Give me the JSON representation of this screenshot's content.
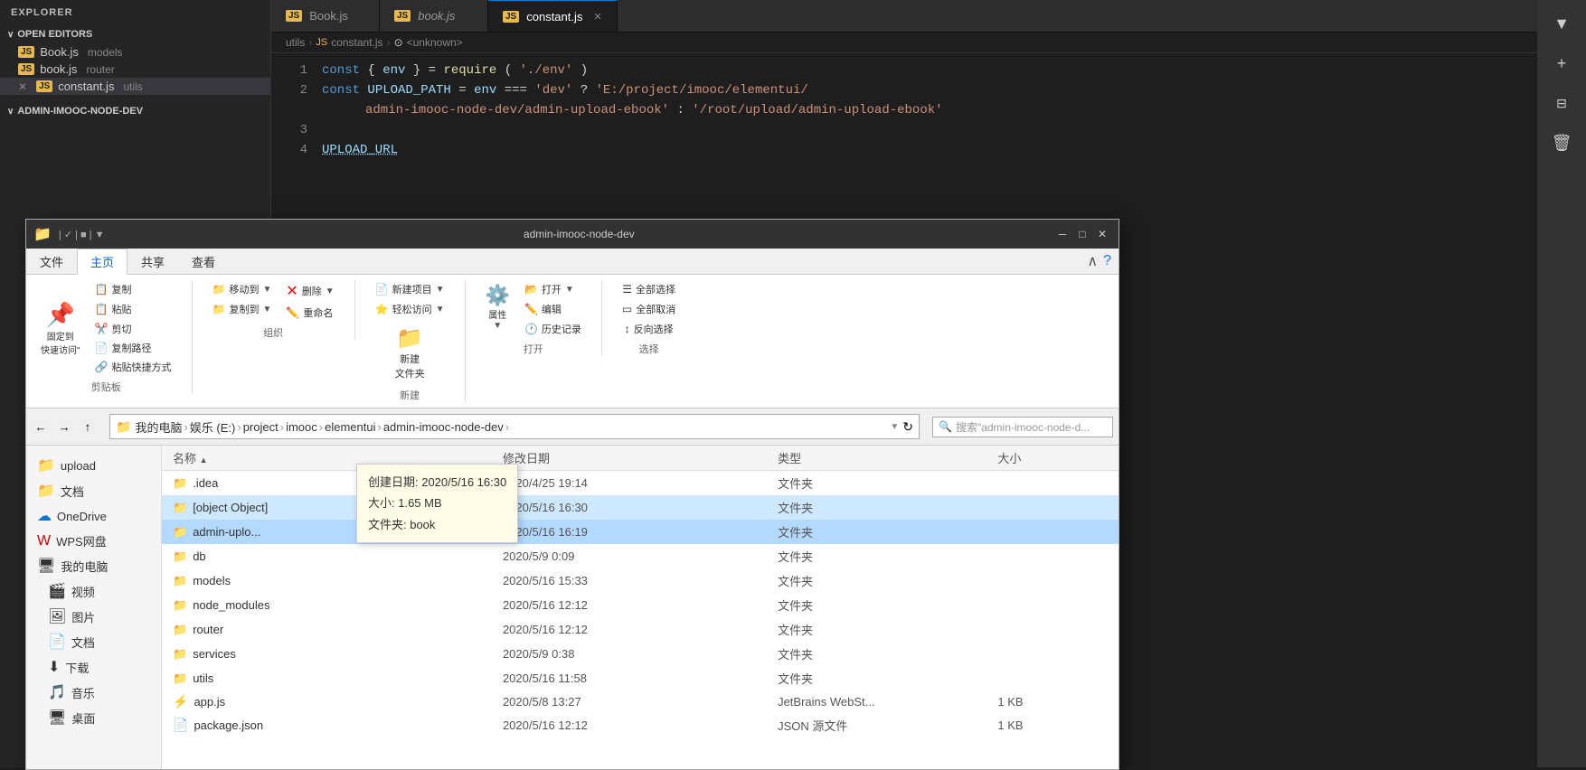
{
  "vscode": {
    "sidebar_title": "EXPLORER",
    "open_editors_label": "OPEN EDITORS",
    "project_label": "ADMIN-IMOOC-NODE-DEV",
    "open_files": [
      {
        "name": "Book.js",
        "sub": "models",
        "active": false
      },
      {
        "name": "book.js",
        "sub": "router",
        "active": false
      },
      {
        "name": "constant.js",
        "sub": "utils",
        "active": true,
        "has_close": true
      }
    ],
    "tabs": [
      {
        "label": "Book.js",
        "active": false
      },
      {
        "label": "book.js",
        "active": false
      },
      {
        "label": "constant.js",
        "active": true,
        "has_close": true
      }
    ],
    "breadcrumb": [
      "utils",
      "JS constant.js",
      "<unknown>"
    ],
    "code_lines": [
      {
        "num": "1",
        "content": "const { env } = require('./env')"
      },
      {
        "num": "2",
        "content": "const UPLOAD_PATH = env === 'dev' ? 'E:/project/imooc/elementui/"
      },
      {
        "num": "",
        "content": "admin-imooc-node-dev/admin-upload-ebook' : '/root/upload/admin-upload-ebook'"
      },
      {
        "num": "3",
        "content": ""
      },
      {
        "num": "4",
        "content": "// UPLOAD_URL"
      }
    ]
  },
  "file_explorer": {
    "title": "admin-imooc-node-dev",
    "ribbon_tabs": [
      "文件",
      "主页",
      "共享",
      "查看"
    ],
    "active_ribbon_tab": "主页",
    "toolbar_groups": {
      "clipboard": {
        "label": "剪贴板",
        "items": [
          "固定到'快速访问'",
          "复制",
          "粘贴",
          "剪切",
          "复制路径",
          "粘贴快捷方式"
        ]
      },
      "organize": {
        "label": "组织",
        "items": [
          "移动到",
          "复制到",
          "删除",
          "重命名"
        ]
      },
      "new": {
        "label": "新建",
        "items": [
          "新建项目",
          "轻松访问",
          "新建文件夹"
        ]
      },
      "open": {
        "label": "打开",
        "items": [
          "属性",
          "打开",
          "编辑",
          "历史记录"
        ]
      },
      "select": {
        "label": "选择",
        "items": [
          "全部选择",
          "全部取消",
          "反向选择"
        ]
      }
    },
    "address_path": [
      "我的电脑",
      "娱乐 (E:)",
      "project",
      "imooc",
      "elementui",
      "admin-imooc-node-dev"
    ],
    "search_placeholder": "搜索\"admin-imooc-node-d...\"",
    "nav_items": [
      "upload",
      "文档",
      "OneDrive",
      "WPS网盘",
      "我的电脑",
      "视频",
      "图片",
      "文档",
      "下载",
      "音乐",
      "桌面"
    ],
    "table_headers": [
      "名称",
      "修改日期",
      "类型",
      "大小"
    ],
    "files": [
      {
        "name": ".idea",
        "date": "2020/4/25 19:14",
        "type": "文件夹",
        "size": ""
      },
      {
        "name": "[object Object]",
        "date": "2020/5/16 16:30",
        "type": "文件夹",
        "size": "",
        "selected": true,
        "has_arrow": true
      },
      {
        "name": "admin-uplo...",
        "date": "2020/5/16 16:19",
        "type": "文件夹",
        "size": "",
        "selected": true
      },
      {
        "name": "db",
        "date": "2020/5/9 0:09",
        "type": "文件夹",
        "size": ""
      },
      {
        "name": "models",
        "date": "2020/5/16 15:33",
        "type": "文件夹",
        "size": ""
      },
      {
        "name": "node_modules",
        "date": "2020/5/16 12:12",
        "type": "文件夹",
        "size": ""
      },
      {
        "name": "router",
        "date": "2020/5/16 12:12",
        "type": "文件夹",
        "size": ""
      },
      {
        "name": "services",
        "date": "2020/5/9 0:38",
        "type": "文件夹",
        "size": ""
      },
      {
        "name": "utils",
        "date": "2020/5/16 11:58",
        "type": "文件夹",
        "size": ""
      },
      {
        "name": "app.js",
        "date": "2020/5/8 13:27",
        "type": "JetBrains WebSt...",
        "size": "1 KB",
        "is_file": true
      },
      {
        "name": "package.json",
        "date": "2020/5/16 12:12",
        "type": "JSON 源文件",
        "size": "1 KB",
        "is_file": true
      }
    ],
    "tooltip": {
      "create_date_label": "创建日期: 2020/5/16 16:30",
      "size_label": "大小: 1.65 MB",
      "folder_label": "文件夹: book"
    },
    "window_controls": [
      "─",
      "□",
      "✕"
    ]
  },
  "right_actions": [
    {
      "icon": "▼",
      "name": "dropdown-icon"
    },
    {
      "icon": "+",
      "name": "add-icon"
    },
    {
      "icon": "⊞",
      "name": "split-editor-icon"
    },
    {
      "icon": "🗑",
      "name": "delete-icon"
    }
  ]
}
